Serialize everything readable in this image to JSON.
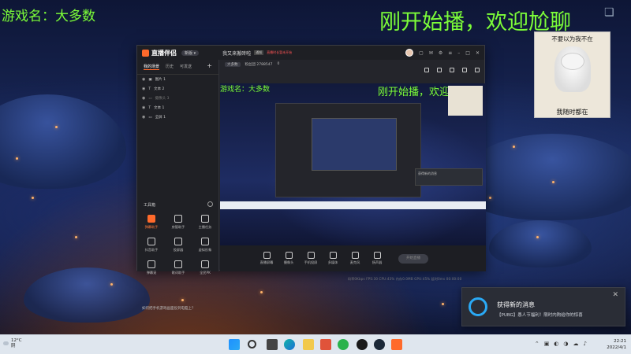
{
  "overlay": {
    "game_name": "游戏名：大多数",
    "welcome": "刚开始播，欢迎尬聊"
  },
  "cat_card": {
    "top_text": "不要以为我不在",
    "bottom_text": "我随时都在"
  },
  "app": {
    "name": "直播伴侣",
    "version_badge": "新版 ▾",
    "room_title": "我又来搬砖啦",
    "badge_tag": "通知",
    "status_tag": "直播时长暂未开始",
    "room_tag": "大多数",
    "room_id_label": "粉丝团 2788547",
    "room_counts": "0",
    "sidebar_tabs": [
      "我的场景",
      "历史",
      "可发送"
    ],
    "sources": [
      {
        "label": "图片 1"
      },
      {
        "label": "文本 2"
      },
      {
        "label": "摄像头 3"
      },
      {
        "label": "文本 1"
      },
      {
        "label": "全屏 1"
      }
    ],
    "tools_header": "工具箱",
    "tools": [
      {
        "label": "弹幕助手",
        "hot": true
      },
      {
        "label": "房管助手",
        "hot": false
      },
      {
        "label": "主播任务",
        "hot": false
      },
      {
        "label": "抖音助手",
        "hot": false
      },
      {
        "label": "投屏器",
        "hot": false
      },
      {
        "label": "虚拟形象",
        "hot": false
      },
      {
        "label": "弹幕宠",
        "hot": false
      },
      {
        "label": "歌词助手",
        "hot": false
      },
      {
        "label": "全民PK",
        "hot": false
      },
      {
        "label": "",
        "hot": false
      },
      {
        "label": "",
        "hot": false
      },
      {
        "label": "",
        "hot": false
      }
    ],
    "tip": "如何把手机游戏画面投到电脑上？",
    "bottom_buttons": [
      "直播屏幕",
      "摄像头",
      "手机投屏",
      "多媒体",
      "麦克风",
      "扬声器"
    ],
    "go_live": "开始直播",
    "stats": "码率0Kbps    FPS:30    CPU:43%    内存0.0MB    GPU:45%    延时0ms    00:00:00"
  },
  "notification": {
    "title": "获得新的消息",
    "message": "【PUBG】愚人节福利！限时内购给你的惊喜"
  },
  "taskbar": {
    "temp": "12°C",
    "weather": "阴",
    "time": "22:21",
    "date": "2022/4/1"
  },
  "colors": {
    "overlay_green": "#7cfc3a",
    "accent_orange": "#ff6a2b",
    "notif_blue": "#2aa9f5"
  }
}
